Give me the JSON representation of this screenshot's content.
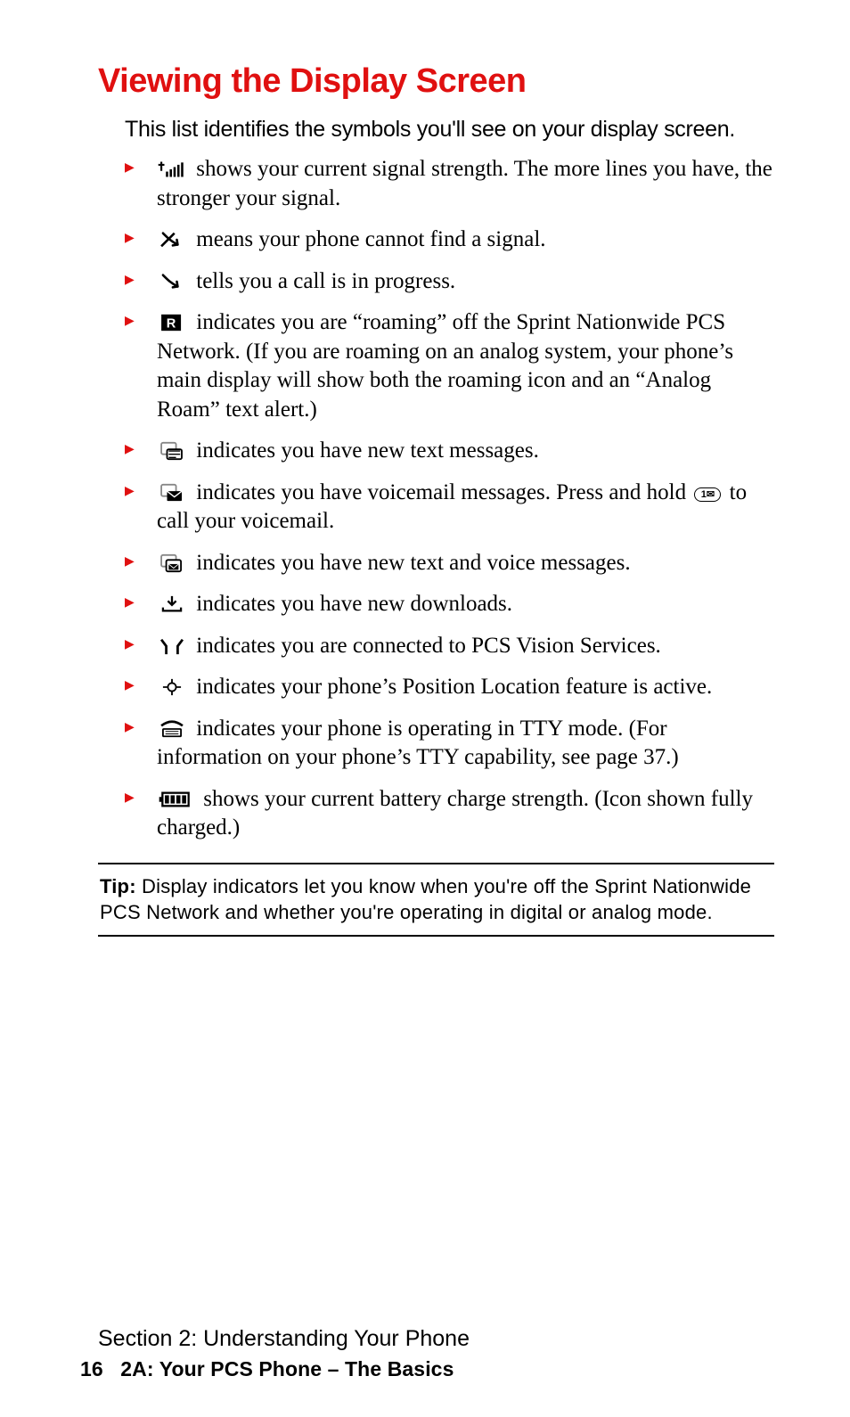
{
  "heading": "Viewing the Display Screen",
  "intro": "This list identifies the symbols you'll see on your display screen.",
  "items": [
    {
      "icon": "signal-bars-icon",
      "text_after": "shows your current signal strength. The more lines you have, the stronger your signal."
    },
    {
      "icon": "no-signal-icon",
      "text_after": "means your phone cannot find a signal."
    },
    {
      "icon": "call-progress-icon",
      "text_after": "tells you a call is in progress."
    },
    {
      "icon": "roaming-icon",
      "text_after": "indicates you are “roaming” off the Sprint Nationwide PCS Network. (If you are roaming on an analog system, your phone’s main display will show both the roaming icon and an “Analog Roam” text alert.)"
    },
    {
      "icon": "text-message-icon",
      "text_after": "indicates you have new text messages."
    },
    {
      "icon": "voicemail-icon",
      "text_before": "",
      "text_after": "indicates you have voicemail messages. Press and hold ",
      "key_label": "1✉",
      "text_tail": " to call your voicemail."
    },
    {
      "icon": "text-voice-icon",
      "text_after": "indicates you have new text and voice messages."
    },
    {
      "icon": "downloads-icon",
      "text_after": "indicates you have new downloads."
    },
    {
      "icon": "pcs-vision-icon",
      "text_after": "indicates you are connected to PCS Vision Services."
    },
    {
      "icon": "position-icon",
      "text_after": "indicates your phone’s Position Location feature is active."
    },
    {
      "icon": "tty-icon",
      "text_after": "indicates your phone is operating in TTY mode. (For information on your phone’s TTY capability, see page 37.)"
    },
    {
      "icon": "battery-icon",
      "text_after": "shows your current battery charge strength. (Icon shown fully charged.)"
    }
  ],
  "tip": {
    "label": "Tip:",
    "text": " Display indicators let you know when you're off the Sprint Nationwide PCS Network and whether you're operating in digital or analog mode."
  },
  "footer": {
    "section_line": "Section 2: Understanding Your Phone",
    "page_number": "16",
    "page_title": "2A: Your PCS Phone – The Basics"
  }
}
